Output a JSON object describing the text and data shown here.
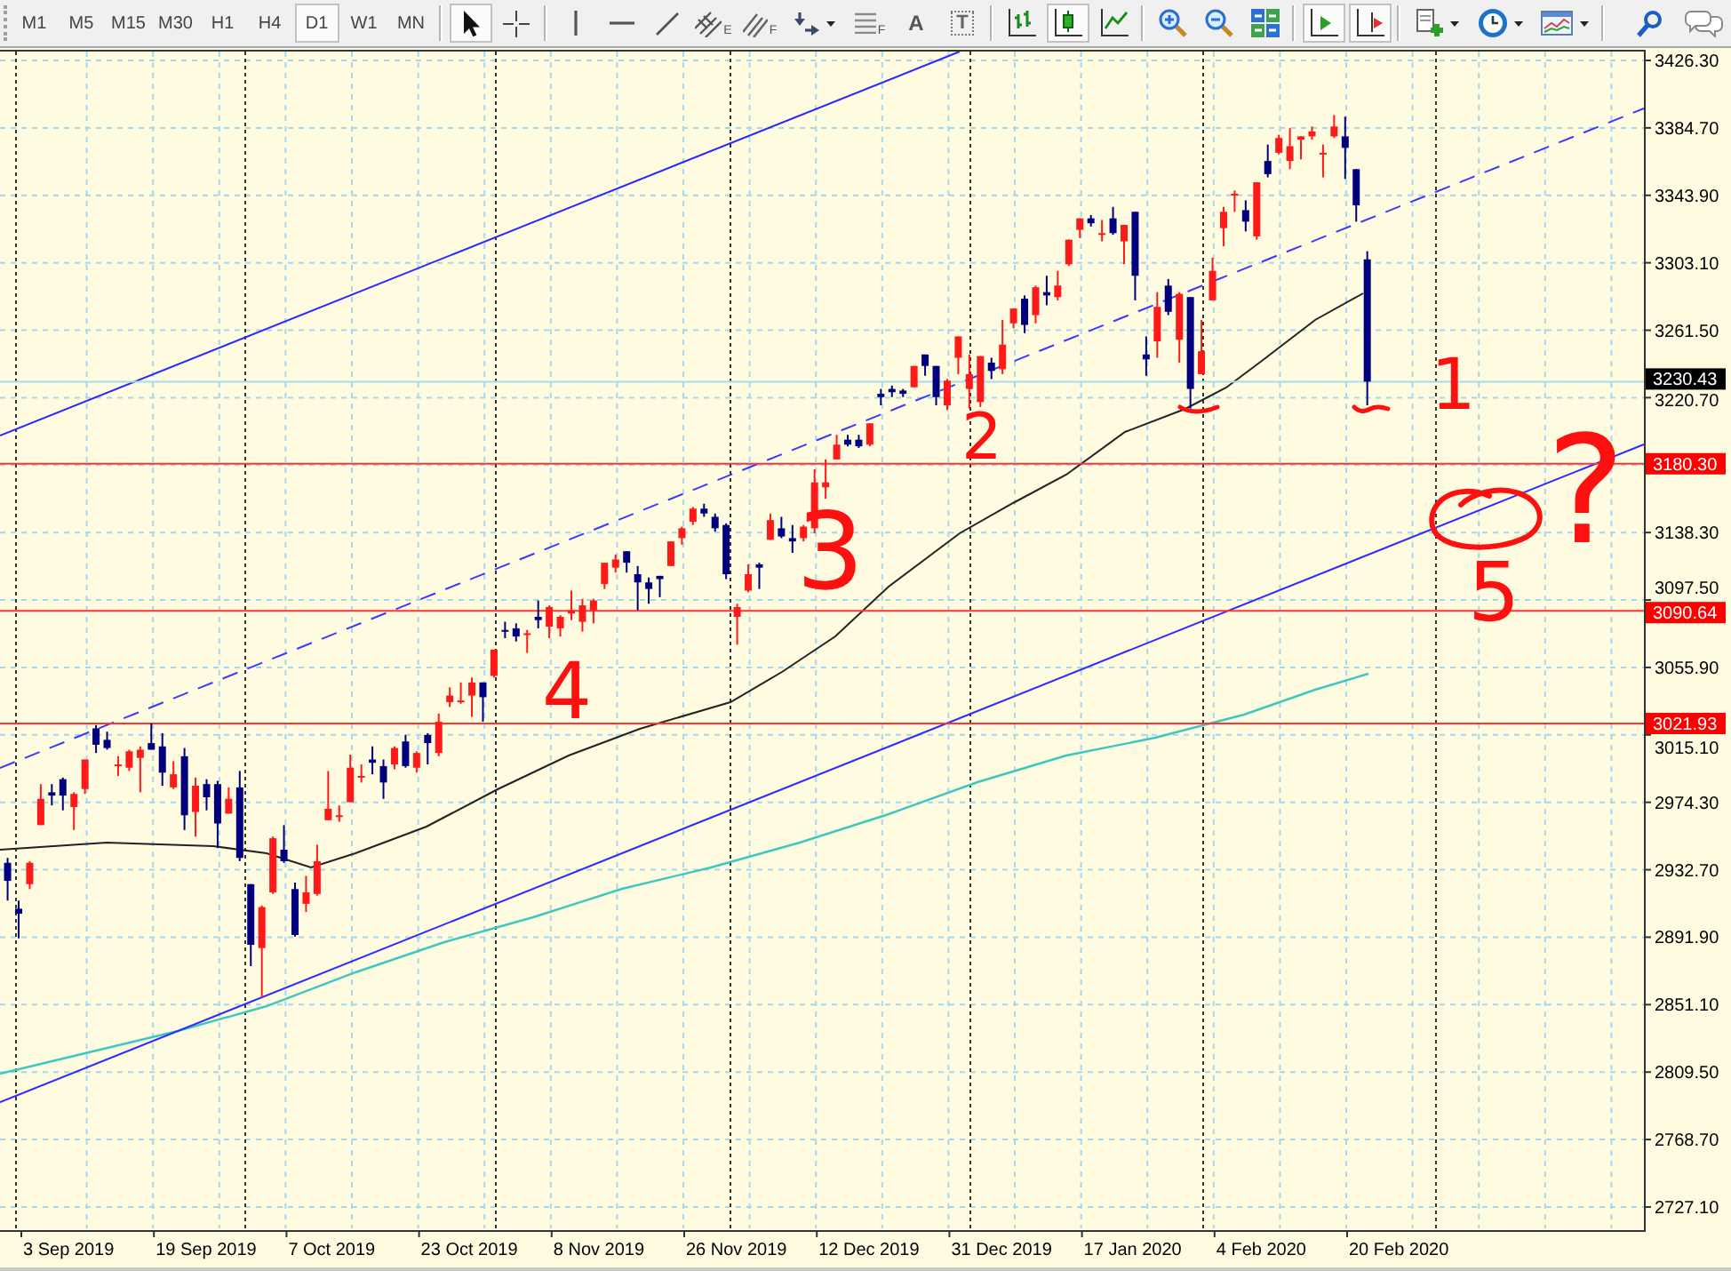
{
  "toolbar": {
    "timeframes": [
      {
        "label": "M1",
        "selected": false
      },
      {
        "label": "M5",
        "selected": false
      },
      {
        "label": "M15",
        "selected": false
      },
      {
        "label": "M30",
        "selected": false
      },
      {
        "label": "H1",
        "selected": false
      },
      {
        "label": "H4",
        "selected": false
      },
      {
        "label": "D1",
        "selected": true
      },
      {
        "label": "W1",
        "selected": false
      },
      {
        "label": "MN",
        "selected": false
      }
    ],
    "tool_groups": [
      {
        "tools": [
          {
            "kind": "cursor",
            "selected": true
          },
          {
            "kind": "crosshair",
            "selected": false
          }
        ]
      },
      {
        "tools": [
          {
            "kind": "vline",
            "selected": false
          },
          {
            "kind": "hline",
            "selected": false
          },
          {
            "kind": "trendline",
            "selected": false
          },
          {
            "kind": "channel",
            "sub": "E",
            "selected": false
          },
          {
            "kind": "fibofan",
            "sub": "F",
            "selected": false
          },
          {
            "kind": "arrows",
            "selected": false,
            "dropdown": true
          },
          {
            "kind": "fibolevels",
            "sub": "F",
            "selected": false
          },
          {
            "kind": "text",
            "label": "A",
            "selected": false
          },
          {
            "kind": "label",
            "label": "T",
            "selected": false
          }
        ]
      },
      {
        "tools": [
          {
            "kind": "barchart",
            "selected": false
          },
          {
            "kind": "candles",
            "selected": true
          },
          {
            "kind": "linechart",
            "selected": false
          }
        ]
      },
      {
        "tools": [
          {
            "kind": "zoomin",
            "selected": false
          },
          {
            "kind": "zoomout",
            "selected": false
          },
          {
            "kind": "tile",
            "selected": false
          }
        ]
      },
      {
        "tools": [
          {
            "kind": "autoscroll",
            "selected": true
          },
          {
            "kind": "shift",
            "selected": true
          }
        ]
      },
      {
        "tools": [
          {
            "kind": "newchart",
            "selected": false,
            "dropdown": true
          },
          {
            "kind": "periods",
            "selected": false,
            "dropdown": true
          },
          {
            "kind": "templates",
            "selected": false,
            "dropdown": true
          }
        ]
      },
      {
        "tools": [
          {
            "kind": "search",
            "selected": false
          },
          {
            "kind": "chat",
            "selected": false
          }
        ]
      }
    ]
  },
  "chart": {
    "price_axis": {
      "labels": [
        "3426.30",
        "3384.70",
        "3343.90",
        "3303.10",
        "3261.50",
        "3220.70",
        "3138.30",
        "3097.50",
        "3055.90",
        "3015.10",
        "2974.30",
        "2932.70",
        "2891.90",
        "2851.10",
        "2809.50",
        "2768.70",
        "2727.10"
      ]
    },
    "price_tags": [
      {
        "text": "3230.43",
        "kind": "bid"
      },
      {
        "text": "3180.30",
        "kind": "level"
      },
      {
        "text": "3090.64",
        "kind": "level"
      },
      {
        "text": "3021.93",
        "kind": "level"
      }
    ],
    "time_axis": {
      "labels": [
        "3 Sep 2019",
        "19 Sep 2019",
        "7 Oct 2019",
        "23 Oct 2019",
        "8 Nov 2019",
        "26 Nov 2019",
        "12 Dec 2019",
        "31 Dec 2019",
        "17 Jan 2020",
        "4 Feb 2020",
        "20 Feb 2020"
      ]
    },
    "annotations": [
      {
        "text": "1"
      },
      {
        "text": "2"
      },
      {
        "text": "3"
      },
      {
        "text": "4"
      },
      {
        "text": "5"
      },
      {
        "text": "?"
      }
    ]
  }
}
